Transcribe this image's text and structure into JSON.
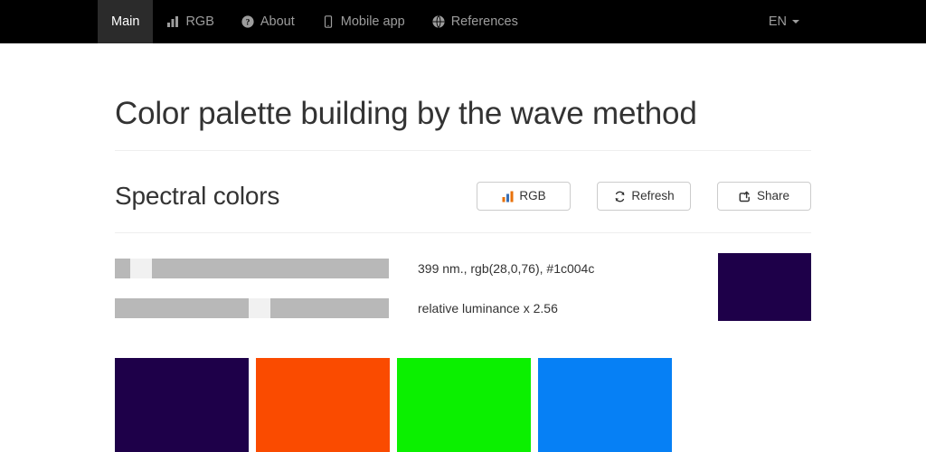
{
  "navbar": {
    "items": [
      {
        "label": "Main",
        "icon": "none",
        "active": true
      },
      {
        "label": "RGB",
        "icon": "chart-icon",
        "active": false
      },
      {
        "label": "About",
        "icon": "help-icon",
        "active": false
      },
      {
        "label": "Mobile app",
        "icon": "mobile-icon",
        "active": false
      },
      {
        "label": "References",
        "icon": "globe-icon",
        "active": false
      }
    ],
    "language": "EN",
    "background": "#000000",
    "active_background": "#2b2b2b",
    "text_color": "#9d9d9d"
  },
  "page": {
    "title": "Color palette building by the wave method"
  },
  "section": {
    "title": "Spectral colors",
    "buttons": [
      {
        "label": "RGB",
        "icon": "bar-chart-icon"
      },
      {
        "label": "Refresh",
        "icon": "refresh-icon"
      },
      {
        "label": "Share",
        "icon": "share-icon"
      }
    ]
  },
  "controls": {
    "wavelength": {
      "label": "399 nm., rgb(28,0,76), #1c004c",
      "nm": 399,
      "rgb": "rgb(28,0,76)",
      "hex": "#1c004c",
      "handle_percent": 6,
      "track_color": "#b8b8b8",
      "handle_color": "#f1f1f1"
    },
    "luminance": {
      "label": "relative luminance x 2.56",
      "multiplier": 2.56,
      "handle_percent": 53,
      "track_color": "#b8b8b8",
      "handle_color": "#f1f1f1"
    },
    "preview_swatch": "#1e0049"
  },
  "palette": {
    "swatches": [
      {
        "name": "swatch-1",
        "color": "#1e0049"
      },
      {
        "name": "swatch-2",
        "color": "#fa4b00"
      },
      {
        "name": "swatch-3",
        "color": "#0bf000"
      },
      {
        "name": "swatch-4",
        "color": "#0680f5"
      }
    ]
  }
}
